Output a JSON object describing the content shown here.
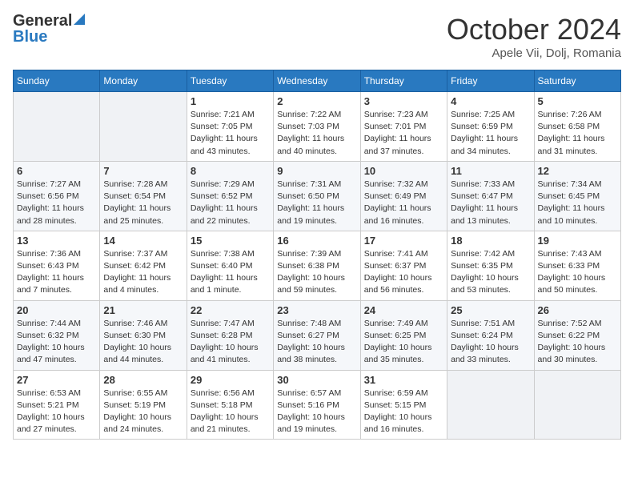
{
  "header": {
    "logo_general": "General",
    "logo_blue": "Blue",
    "title": "October 2024",
    "location": "Apele Vii, Dolj, Romania"
  },
  "weekdays": [
    "Sunday",
    "Monday",
    "Tuesday",
    "Wednesday",
    "Thursday",
    "Friday",
    "Saturday"
  ],
  "weeks": [
    [
      {
        "day": "",
        "info": ""
      },
      {
        "day": "",
        "info": ""
      },
      {
        "day": "1",
        "info": "Sunrise: 7:21 AM\nSunset: 7:05 PM\nDaylight: 11 hours and 43 minutes."
      },
      {
        "day": "2",
        "info": "Sunrise: 7:22 AM\nSunset: 7:03 PM\nDaylight: 11 hours and 40 minutes."
      },
      {
        "day": "3",
        "info": "Sunrise: 7:23 AM\nSunset: 7:01 PM\nDaylight: 11 hours and 37 minutes."
      },
      {
        "day": "4",
        "info": "Sunrise: 7:25 AM\nSunset: 6:59 PM\nDaylight: 11 hours and 34 minutes."
      },
      {
        "day": "5",
        "info": "Sunrise: 7:26 AM\nSunset: 6:58 PM\nDaylight: 11 hours and 31 minutes."
      }
    ],
    [
      {
        "day": "6",
        "info": "Sunrise: 7:27 AM\nSunset: 6:56 PM\nDaylight: 11 hours and 28 minutes."
      },
      {
        "day": "7",
        "info": "Sunrise: 7:28 AM\nSunset: 6:54 PM\nDaylight: 11 hours and 25 minutes."
      },
      {
        "day": "8",
        "info": "Sunrise: 7:29 AM\nSunset: 6:52 PM\nDaylight: 11 hours and 22 minutes."
      },
      {
        "day": "9",
        "info": "Sunrise: 7:31 AM\nSunset: 6:50 PM\nDaylight: 11 hours and 19 minutes."
      },
      {
        "day": "10",
        "info": "Sunrise: 7:32 AM\nSunset: 6:49 PM\nDaylight: 11 hours and 16 minutes."
      },
      {
        "day": "11",
        "info": "Sunrise: 7:33 AM\nSunset: 6:47 PM\nDaylight: 11 hours and 13 minutes."
      },
      {
        "day": "12",
        "info": "Sunrise: 7:34 AM\nSunset: 6:45 PM\nDaylight: 11 hours and 10 minutes."
      }
    ],
    [
      {
        "day": "13",
        "info": "Sunrise: 7:36 AM\nSunset: 6:43 PM\nDaylight: 11 hours and 7 minutes."
      },
      {
        "day": "14",
        "info": "Sunrise: 7:37 AM\nSunset: 6:42 PM\nDaylight: 11 hours and 4 minutes."
      },
      {
        "day": "15",
        "info": "Sunrise: 7:38 AM\nSunset: 6:40 PM\nDaylight: 11 hours and 1 minute."
      },
      {
        "day": "16",
        "info": "Sunrise: 7:39 AM\nSunset: 6:38 PM\nDaylight: 10 hours and 59 minutes."
      },
      {
        "day": "17",
        "info": "Sunrise: 7:41 AM\nSunset: 6:37 PM\nDaylight: 10 hours and 56 minutes."
      },
      {
        "day": "18",
        "info": "Sunrise: 7:42 AM\nSunset: 6:35 PM\nDaylight: 10 hours and 53 minutes."
      },
      {
        "day": "19",
        "info": "Sunrise: 7:43 AM\nSunset: 6:33 PM\nDaylight: 10 hours and 50 minutes."
      }
    ],
    [
      {
        "day": "20",
        "info": "Sunrise: 7:44 AM\nSunset: 6:32 PM\nDaylight: 10 hours and 47 minutes."
      },
      {
        "day": "21",
        "info": "Sunrise: 7:46 AM\nSunset: 6:30 PM\nDaylight: 10 hours and 44 minutes."
      },
      {
        "day": "22",
        "info": "Sunrise: 7:47 AM\nSunset: 6:28 PM\nDaylight: 10 hours and 41 minutes."
      },
      {
        "day": "23",
        "info": "Sunrise: 7:48 AM\nSunset: 6:27 PM\nDaylight: 10 hours and 38 minutes."
      },
      {
        "day": "24",
        "info": "Sunrise: 7:49 AM\nSunset: 6:25 PM\nDaylight: 10 hours and 35 minutes."
      },
      {
        "day": "25",
        "info": "Sunrise: 7:51 AM\nSunset: 6:24 PM\nDaylight: 10 hours and 33 minutes."
      },
      {
        "day": "26",
        "info": "Sunrise: 7:52 AM\nSunset: 6:22 PM\nDaylight: 10 hours and 30 minutes."
      }
    ],
    [
      {
        "day": "27",
        "info": "Sunrise: 6:53 AM\nSunset: 5:21 PM\nDaylight: 10 hours and 27 minutes."
      },
      {
        "day": "28",
        "info": "Sunrise: 6:55 AM\nSunset: 5:19 PM\nDaylight: 10 hours and 24 minutes."
      },
      {
        "day": "29",
        "info": "Sunrise: 6:56 AM\nSunset: 5:18 PM\nDaylight: 10 hours and 21 minutes."
      },
      {
        "day": "30",
        "info": "Sunrise: 6:57 AM\nSunset: 5:16 PM\nDaylight: 10 hours and 19 minutes."
      },
      {
        "day": "31",
        "info": "Sunrise: 6:59 AM\nSunset: 5:15 PM\nDaylight: 10 hours and 16 minutes."
      },
      {
        "day": "",
        "info": ""
      },
      {
        "day": "",
        "info": ""
      }
    ]
  ]
}
